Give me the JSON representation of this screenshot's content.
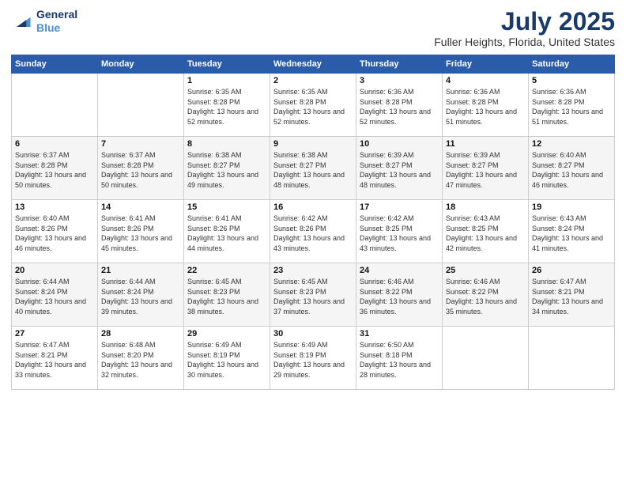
{
  "header": {
    "logo_line1": "General",
    "logo_line2": "Blue",
    "month": "July 2025",
    "location": "Fuller Heights, Florida, United States"
  },
  "weekdays": [
    "Sunday",
    "Monday",
    "Tuesday",
    "Wednesday",
    "Thursday",
    "Friday",
    "Saturday"
  ],
  "weeks": [
    [
      {
        "day": "",
        "sunrise": "",
        "sunset": "",
        "daylight": ""
      },
      {
        "day": "",
        "sunrise": "",
        "sunset": "",
        "daylight": ""
      },
      {
        "day": "1",
        "sunrise": "Sunrise: 6:35 AM",
        "sunset": "Sunset: 8:28 PM",
        "daylight": "Daylight: 13 hours and 52 minutes."
      },
      {
        "day": "2",
        "sunrise": "Sunrise: 6:35 AM",
        "sunset": "Sunset: 8:28 PM",
        "daylight": "Daylight: 13 hours and 52 minutes."
      },
      {
        "day": "3",
        "sunrise": "Sunrise: 6:36 AM",
        "sunset": "Sunset: 8:28 PM",
        "daylight": "Daylight: 13 hours and 52 minutes."
      },
      {
        "day": "4",
        "sunrise": "Sunrise: 6:36 AM",
        "sunset": "Sunset: 8:28 PM",
        "daylight": "Daylight: 13 hours and 51 minutes."
      },
      {
        "day": "5",
        "sunrise": "Sunrise: 6:36 AM",
        "sunset": "Sunset: 8:28 PM",
        "daylight": "Daylight: 13 hours and 51 minutes."
      }
    ],
    [
      {
        "day": "6",
        "sunrise": "Sunrise: 6:37 AM",
        "sunset": "Sunset: 8:28 PM",
        "daylight": "Daylight: 13 hours and 50 minutes."
      },
      {
        "day": "7",
        "sunrise": "Sunrise: 6:37 AM",
        "sunset": "Sunset: 8:28 PM",
        "daylight": "Daylight: 13 hours and 50 minutes."
      },
      {
        "day": "8",
        "sunrise": "Sunrise: 6:38 AM",
        "sunset": "Sunset: 8:27 PM",
        "daylight": "Daylight: 13 hours and 49 minutes."
      },
      {
        "day": "9",
        "sunrise": "Sunrise: 6:38 AM",
        "sunset": "Sunset: 8:27 PM",
        "daylight": "Daylight: 13 hours and 48 minutes."
      },
      {
        "day": "10",
        "sunrise": "Sunrise: 6:39 AM",
        "sunset": "Sunset: 8:27 PM",
        "daylight": "Daylight: 13 hours and 48 minutes."
      },
      {
        "day": "11",
        "sunrise": "Sunrise: 6:39 AM",
        "sunset": "Sunset: 8:27 PM",
        "daylight": "Daylight: 13 hours and 47 minutes."
      },
      {
        "day": "12",
        "sunrise": "Sunrise: 6:40 AM",
        "sunset": "Sunset: 8:27 PM",
        "daylight": "Daylight: 13 hours and 46 minutes."
      }
    ],
    [
      {
        "day": "13",
        "sunrise": "Sunrise: 6:40 AM",
        "sunset": "Sunset: 8:26 PM",
        "daylight": "Daylight: 13 hours and 46 minutes."
      },
      {
        "day": "14",
        "sunrise": "Sunrise: 6:41 AM",
        "sunset": "Sunset: 8:26 PM",
        "daylight": "Daylight: 13 hours and 45 minutes."
      },
      {
        "day": "15",
        "sunrise": "Sunrise: 6:41 AM",
        "sunset": "Sunset: 8:26 PM",
        "daylight": "Daylight: 13 hours and 44 minutes."
      },
      {
        "day": "16",
        "sunrise": "Sunrise: 6:42 AM",
        "sunset": "Sunset: 8:26 PM",
        "daylight": "Daylight: 13 hours and 43 minutes."
      },
      {
        "day": "17",
        "sunrise": "Sunrise: 6:42 AM",
        "sunset": "Sunset: 8:25 PM",
        "daylight": "Daylight: 13 hours and 43 minutes."
      },
      {
        "day": "18",
        "sunrise": "Sunrise: 6:43 AM",
        "sunset": "Sunset: 8:25 PM",
        "daylight": "Daylight: 13 hours and 42 minutes."
      },
      {
        "day": "19",
        "sunrise": "Sunrise: 6:43 AM",
        "sunset": "Sunset: 8:24 PM",
        "daylight": "Daylight: 13 hours and 41 minutes."
      }
    ],
    [
      {
        "day": "20",
        "sunrise": "Sunrise: 6:44 AM",
        "sunset": "Sunset: 8:24 PM",
        "daylight": "Daylight: 13 hours and 40 minutes."
      },
      {
        "day": "21",
        "sunrise": "Sunrise: 6:44 AM",
        "sunset": "Sunset: 8:24 PM",
        "daylight": "Daylight: 13 hours and 39 minutes."
      },
      {
        "day": "22",
        "sunrise": "Sunrise: 6:45 AM",
        "sunset": "Sunset: 8:23 PM",
        "daylight": "Daylight: 13 hours and 38 minutes."
      },
      {
        "day": "23",
        "sunrise": "Sunrise: 6:45 AM",
        "sunset": "Sunset: 8:23 PM",
        "daylight": "Daylight: 13 hours and 37 minutes."
      },
      {
        "day": "24",
        "sunrise": "Sunrise: 6:46 AM",
        "sunset": "Sunset: 8:22 PM",
        "daylight": "Daylight: 13 hours and 36 minutes."
      },
      {
        "day": "25",
        "sunrise": "Sunrise: 6:46 AM",
        "sunset": "Sunset: 8:22 PM",
        "daylight": "Daylight: 13 hours and 35 minutes."
      },
      {
        "day": "26",
        "sunrise": "Sunrise: 6:47 AM",
        "sunset": "Sunset: 8:21 PM",
        "daylight": "Daylight: 13 hours and 34 minutes."
      }
    ],
    [
      {
        "day": "27",
        "sunrise": "Sunrise: 6:47 AM",
        "sunset": "Sunset: 8:21 PM",
        "daylight": "Daylight: 13 hours and 33 minutes."
      },
      {
        "day": "28",
        "sunrise": "Sunrise: 6:48 AM",
        "sunset": "Sunset: 8:20 PM",
        "daylight": "Daylight: 13 hours and 32 minutes."
      },
      {
        "day": "29",
        "sunrise": "Sunrise: 6:49 AM",
        "sunset": "Sunset: 8:19 PM",
        "daylight": "Daylight: 13 hours and 30 minutes."
      },
      {
        "day": "30",
        "sunrise": "Sunrise: 6:49 AM",
        "sunset": "Sunset: 8:19 PM",
        "daylight": "Daylight: 13 hours and 29 minutes."
      },
      {
        "day": "31",
        "sunrise": "Sunrise: 6:50 AM",
        "sunset": "Sunset: 8:18 PM",
        "daylight": "Daylight: 13 hours and 28 minutes."
      },
      {
        "day": "",
        "sunrise": "",
        "sunset": "",
        "daylight": ""
      },
      {
        "day": "",
        "sunrise": "",
        "sunset": "",
        "daylight": ""
      }
    ]
  ]
}
